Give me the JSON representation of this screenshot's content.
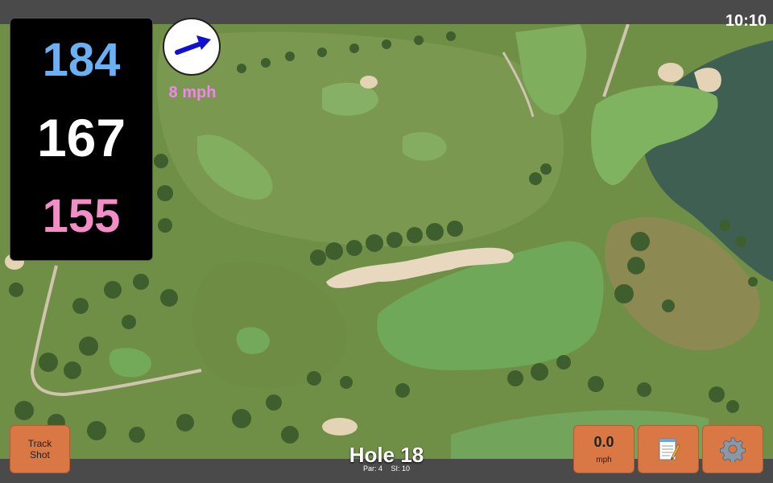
{
  "status_bar": {
    "time": "10:10"
  },
  "distances": {
    "back": "184",
    "middle": "167",
    "front": "155"
  },
  "wind": {
    "speed": "8 mph",
    "icon": "wind-arrow-icon",
    "direction_hint": "towards upper-right"
  },
  "buttons": {
    "track_shot": {
      "line1": "Track",
      "line2": "Shot"
    },
    "speed": {
      "value": "0.0",
      "unit": "mph"
    },
    "notes": {
      "icon": "notepad-icon"
    },
    "settings": {
      "icon": "gear-icon"
    }
  },
  "hole": {
    "title": "Hole 18",
    "par": "Par: 4",
    "si": "SI: 10"
  },
  "colors": {
    "back": "#6ab0f5",
    "middle": "#ffffff",
    "front": "#f48cc8",
    "wind_speed": "#ee88e8",
    "button": "#d97745",
    "bar": "#4a4a4a"
  }
}
